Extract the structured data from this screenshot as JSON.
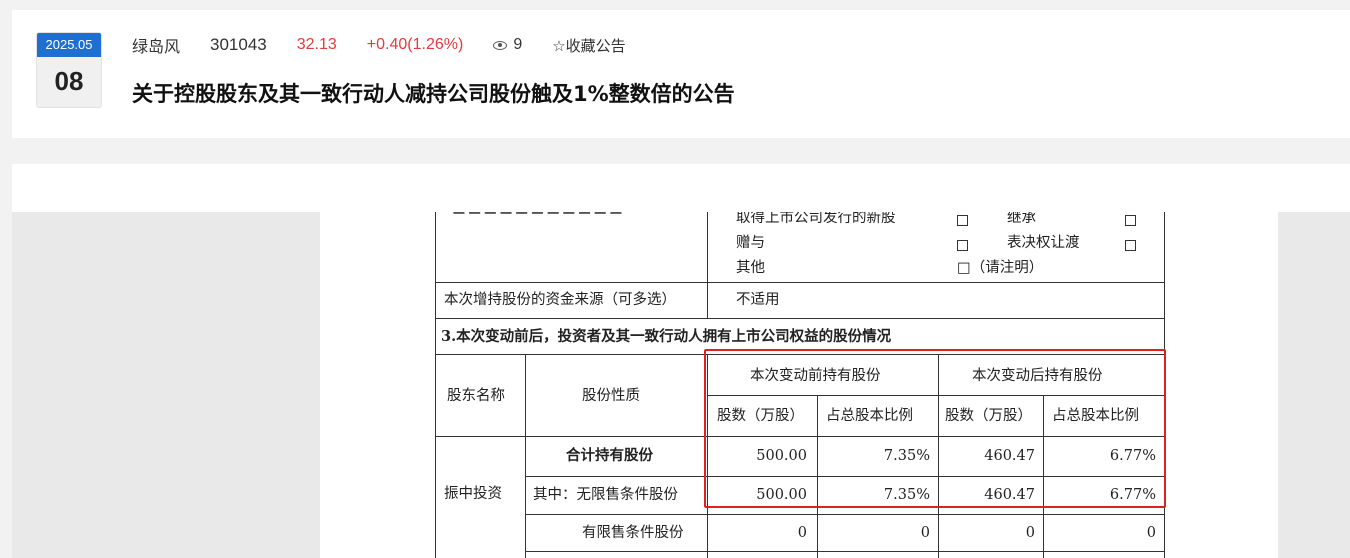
{
  "header": {
    "date_month": "2025.05",
    "date_day": "08",
    "stock_name": "绿岛风",
    "stock_code": "301043",
    "price": "32.13",
    "change": "+0.40(1.26%)",
    "views": "9",
    "favorite_label": "☆收藏公告",
    "title": "关于控股股东及其一致行动人减持公司股份触及1%整数倍的公告",
    "accent_color": "#1f6fd0",
    "up_color": "#e23c3c"
  },
  "document": {
    "options": {
      "new_shares": "取得上市公司发行的新股",
      "inherit": "继承",
      "gift": "赠与",
      "vote_transfer": "表决权让渡",
      "other": "其他",
      "specify": "□（请注明）"
    },
    "fund_source_label": "本次增持股份的资金来源（可多选）",
    "fund_source_value": "不适用",
    "section3_title": "3.本次变动前后，投资者及其一致行动人拥有上市公司权益的股份情况",
    "table": {
      "col_shareholder": "股东名称",
      "col_share_type": "股份性质",
      "col_before": "本次变动前持有股份",
      "col_after": "本次变动后持有股份",
      "col_shares": "股数（万股）",
      "col_ratio": "占总股本比例",
      "shareholder": "振中投资",
      "rows": [
        {
          "type": "合计持有股份",
          "before_shares": "500.00",
          "before_ratio": "7.35%",
          "after_shares": "460.47",
          "after_ratio": "6.77%"
        },
        {
          "type": "其中：无限售条件股份",
          "before_shares": "500.00",
          "before_ratio": "7.35%",
          "after_shares": "460.47",
          "after_ratio": "6.77%"
        },
        {
          "type": "有限售条件股份",
          "before_shares": "0",
          "before_ratio": "0",
          "after_shares": "0",
          "after_ratio": "0"
        }
      ]
    },
    "highlight_color": "#e02020"
  }
}
